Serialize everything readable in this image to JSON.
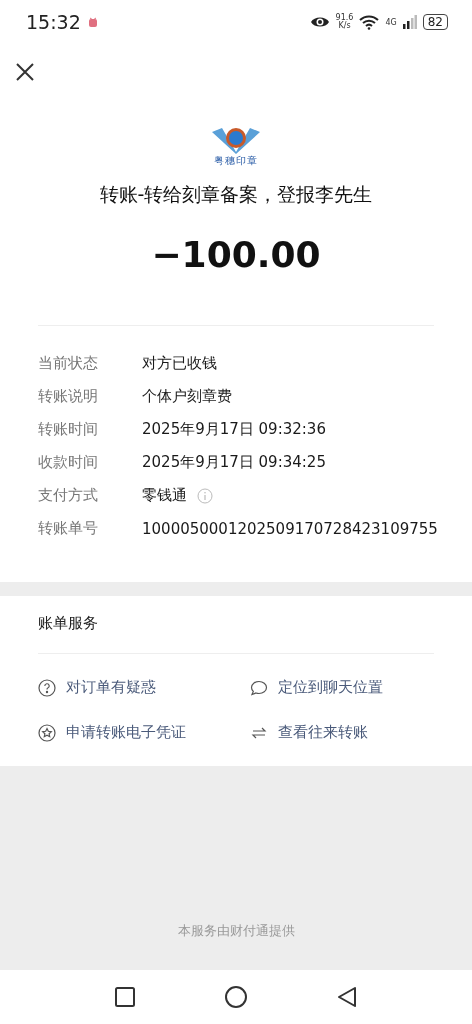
{
  "status_bar": {
    "time": "15:32",
    "net_speed": "91.6",
    "net_unit": "K/s",
    "network": "4G",
    "battery": "82"
  },
  "header": {
    "logo_text": "粤穗印章",
    "title": "转账-转给刻章备案，登报李先生",
    "amount": "−100.00"
  },
  "details": [
    {
      "label": "当前状态",
      "value": "对方已收钱",
      "info": false
    },
    {
      "label": "转账说明",
      "value": "个体户刻章费",
      "info": false
    },
    {
      "label": "转账时间",
      "value": "2025年9月17日 09:32:36",
      "info": false
    },
    {
      "label": "收款时间",
      "value": "2025年9月17日 09:34:25",
      "info": false
    },
    {
      "label": "支付方式",
      "value": "零钱通",
      "info": true
    },
    {
      "label": "转账单号",
      "value": "1000050001202509170728423109755",
      "info": false
    }
  ],
  "services": {
    "title": "账单服务",
    "items": [
      {
        "kind": "question",
        "label": "对订单有疑惑"
      },
      {
        "kind": "chat",
        "label": "定位到聊天位置"
      },
      {
        "kind": "star",
        "label": "申请转账电子凭证"
      },
      {
        "kind": "exchange",
        "label": "查看往来转账"
      }
    ]
  },
  "footer": "本服务由财付通提供"
}
